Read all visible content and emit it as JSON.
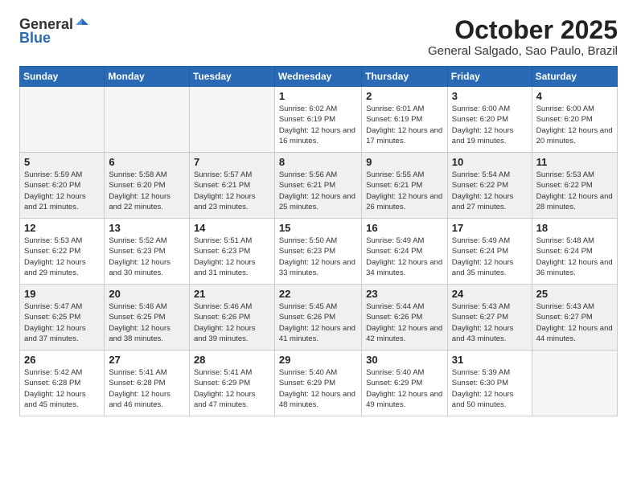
{
  "logo": {
    "text1": "General",
    "text2": "Blue"
  },
  "header": {
    "month": "October 2025",
    "location": "General Salgado, Sao Paulo, Brazil"
  },
  "weekdays": [
    "Sunday",
    "Monday",
    "Tuesday",
    "Wednesday",
    "Thursday",
    "Friday",
    "Saturday"
  ],
  "weeks": [
    [
      {
        "day": "",
        "info": ""
      },
      {
        "day": "",
        "info": ""
      },
      {
        "day": "",
        "info": ""
      },
      {
        "day": "1",
        "info": "Sunrise: 6:02 AM\nSunset: 6:19 PM\nDaylight: 12 hours\nand 16 minutes."
      },
      {
        "day": "2",
        "info": "Sunrise: 6:01 AM\nSunset: 6:19 PM\nDaylight: 12 hours\nand 17 minutes."
      },
      {
        "day": "3",
        "info": "Sunrise: 6:00 AM\nSunset: 6:20 PM\nDaylight: 12 hours\nand 19 minutes."
      },
      {
        "day": "4",
        "info": "Sunrise: 6:00 AM\nSunset: 6:20 PM\nDaylight: 12 hours\nand 20 minutes."
      }
    ],
    [
      {
        "day": "5",
        "info": "Sunrise: 5:59 AM\nSunset: 6:20 PM\nDaylight: 12 hours\nand 21 minutes."
      },
      {
        "day": "6",
        "info": "Sunrise: 5:58 AM\nSunset: 6:20 PM\nDaylight: 12 hours\nand 22 minutes."
      },
      {
        "day": "7",
        "info": "Sunrise: 5:57 AM\nSunset: 6:21 PM\nDaylight: 12 hours\nand 23 minutes."
      },
      {
        "day": "8",
        "info": "Sunrise: 5:56 AM\nSunset: 6:21 PM\nDaylight: 12 hours\nand 25 minutes."
      },
      {
        "day": "9",
        "info": "Sunrise: 5:55 AM\nSunset: 6:21 PM\nDaylight: 12 hours\nand 26 minutes."
      },
      {
        "day": "10",
        "info": "Sunrise: 5:54 AM\nSunset: 6:22 PM\nDaylight: 12 hours\nand 27 minutes."
      },
      {
        "day": "11",
        "info": "Sunrise: 5:53 AM\nSunset: 6:22 PM\nDaylight: 12 hours\nand 28 minutes."
      }
    ],
    [
      {
        "day": "12",
        "info": "Sunrise: 5:53 AM\nSunset: 6:22 PM\nDaylight: 12 hours\nand 29 minutes."
      },
      {
        "day": "13",
        "info": "Sunrise: 5:52 AM\nSunset: 6:23 PM\nDaylight: 12 hours\nand 30 minutes."
      },
      {
        "day": "14",
        "info": "Sunrise: 5:51 AM\nSunset: 6:23 PM\nDaylight: 12 hours\nand 31 minutes."
      },
      {
        "day": "15",
        "info": "Sunrise: 5:50 AM\nSunset: 6:23 PM\nDaylight: 12 hours\nand 33 minutes."
      },
      {
        "day": "16",
        "info": "Sunrise: 5:49 AM\nSunset: 6:24 PM\nDaylight: 12 hours\nand 34 minutes."
      },
      {
        "day": "17",
        "info": "Sunrise: 5:49 AM\nSunset: 6:24 PM\nDaylight: 12 hours\nand 35 minutes."
      },
      {
        "day": "18",
        "info": "Sunrise: 5:48 AM\nSunset: 6:24 PM\nDaylight: 12 hours\nand 36 minutes."
      }
    ],
    [
      {
        "day": "19",
        "info": "Sunrise: 5:47 AM\nSunset: 6:25 PM\nDaylight: 12 hours\nand 37 minutes."
      },
      {
        "day": "20",
        "info": "Sunrise: 5:46 AM\nSunset: 6:25 PM\nDaylight: 12 hours\nand 38 minutes."
      },
      {
        "day": "21",
        "info": "Sunrise: 5:46 AM\nSunset: 6:26 PM\nDaylight: 12 hours\nand 39 minutes."
      },
      {
        "day": "22",
        "info": "Sunrise: 5:45 AM\nSunset: 6:26 PM\nDaylight: 12 hours\nand 41 minutes."
      },
      {
        "day": "23",
        "info": "Sunrise: 5:44 AM\nSunset: 6:26 PM\nDaylight: 12 hours\nand 42 minutes."
      },
      {
        "day": "24",
        "info": "Sunrise: 5:43 AM\nSunset: 6:27 PM\nDaylight: 12 hours\nand 43 minutes."
      },
      {
        "day": "25",
        "info": "Sunrise: 5:43 AM\nSunset: 6:27 PM\nDaylight: 12 hours\nand 44 minutes."
      }
    ],
    [
      {
        "day": "26",
        "info": "Sunrise: 5:42 AM\nSunset: 6:28 PM\nDaylight: 12 hours\nand 45 minutes."
      },
      {
        "day": "27",
        "info": "Sunrise: 5:41 AM\nSunset: 6:28 PM\nDaylight: 12 hours\nand 46 minutes."
      },
      {
        "day": "28",
        "info": "Sunrise: 5:41 AM\nSunset: 6:29 PM\nDaylight: 12 hours\nand 47 minutes."
      },
      {
        "day": "29",
        "info": "Sunrise: 5:40 AM\nSunset: 6:29 PM\nDaylight: 12 hours\nand 48 minutes."
      },
      {
        "day": "30",
        "info": "Sunrise: 5:40 AM\nSunset: 6:29 PM\nDaylight: 12 hours\nand 49 minutes."
      },
      {
        "day": "31",
        "info": "Sunrise: 5:39 AM\nSunset: 6:30 PM\nDaylight: 12 hours\nand 50 minutes."
      },
      {
        "day": "",
        "info": ""
      }
    ]
  ]
}
